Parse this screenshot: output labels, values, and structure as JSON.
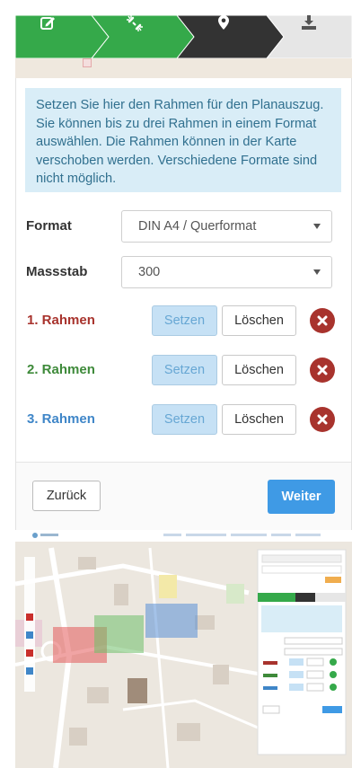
{
  "stepper": {
    "steps": [
      {
        "icon": "edit-icon",
        "state": "done"
      },
      {
        "icon": "unlink-icon",
        "state": "done"
      },
      {
        "icon": "map-marker-icon",
        "state": "active"
      },
      {
        "icon": "download-icon",
        "state": "upcoming"
      }
    ],
    "colors": {
      "done": "#35a94a",
      "active": "#333333",
      "upcoming": "#e6e6e6"
    }
  },
  "info_text": "Setzen Sie hier den Rahmen für den Planauszug. Sie können bis zu drei Rahmen in einem Format auswählen. Die Rahmen können in der Karte verschoben werden. Verschiedene Formate sind nicht möglich.",
  "form": {
    "format_label": "Format",
    "format_value": "DIN A4 / Querformat",
    "massstab_label": "Massstab",
    "massstab_value": "300"
  },
  "rahmen": [
    {
      "label": "1. Rahmen",
      "color": "#a8332d",
      "set_label": "Setzen",
      "delete_label": "Löschen"
    },
    {
      "label": "2. Rahmen",
      "color": "#3e8a3a",
      "set_label": "Setzen",
      "delete_label": "Löschen"
    },
    {
      "label": "3. Rahmen",
      "color": "#3f86c8",
      "set_label": "Setzen",
      "delete_label": "Löschen"
    }
  ],
  "footer": {
    "back_label": "Zurück",
    "next_label": "Weiter"
  },
  "colors": {
    "accent": "#3f9ae5",
    "info_bg": "#d9edf7",
    "delete_icon": "#a8332d"
  }
}
